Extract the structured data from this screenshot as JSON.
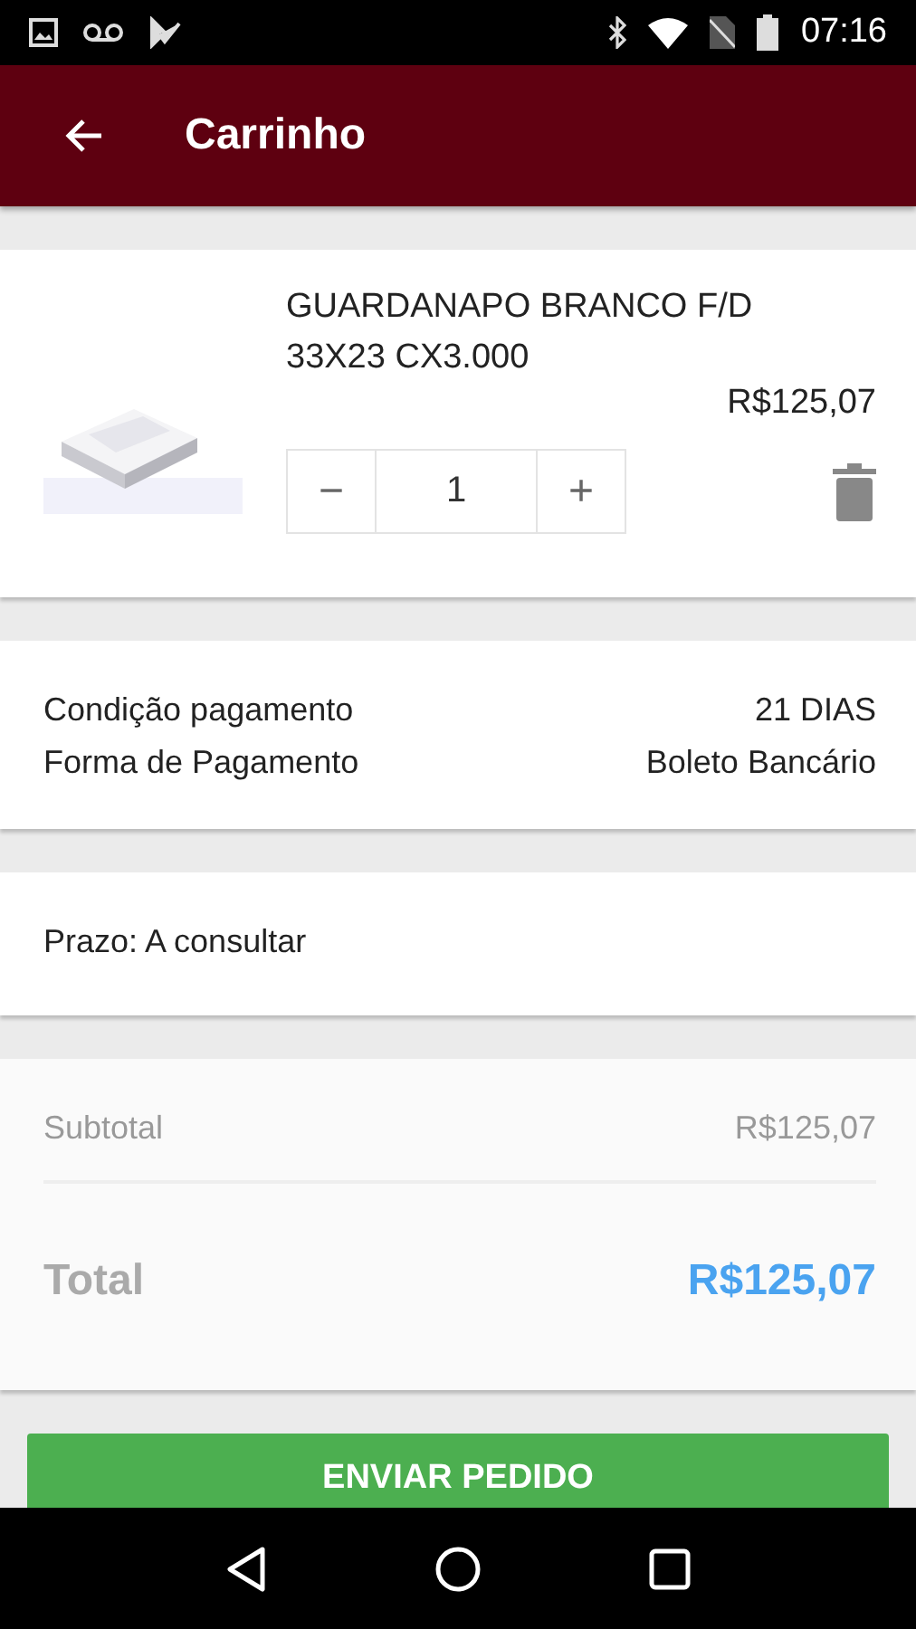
{
  "status_bar": {
    "time": "07:16"
  },
  "app_bar": {
    "title": "Carrinho"
  },
  "cart_items": [
    {
      "name": "GUARDANAPO BRANCO F/D 33X23 CX3.000",
      "price": "R$125,07",
      "quantity": "1",
      "decrease": "−",
      "increase": "+"
    }
  ],
  "payment": [
    {
      "label": "Condição pagamento",
      "value": "21 DIAS"
    },
    {
      "label": "Forma de Pagamento",
      "value": "Boleto Bancário"
    }
  ],
  "delivery": {
    "text": "Prazo: A consultar"
  },
  "summary": {
    "subtotal_label": "Subtotal",
    "subtotal_value": "R$125,07",
    "total_label": "Total",
    "total_value": "R$125,07"
  },
  "submit_button": "ENVIAR PEDIDO"
}
